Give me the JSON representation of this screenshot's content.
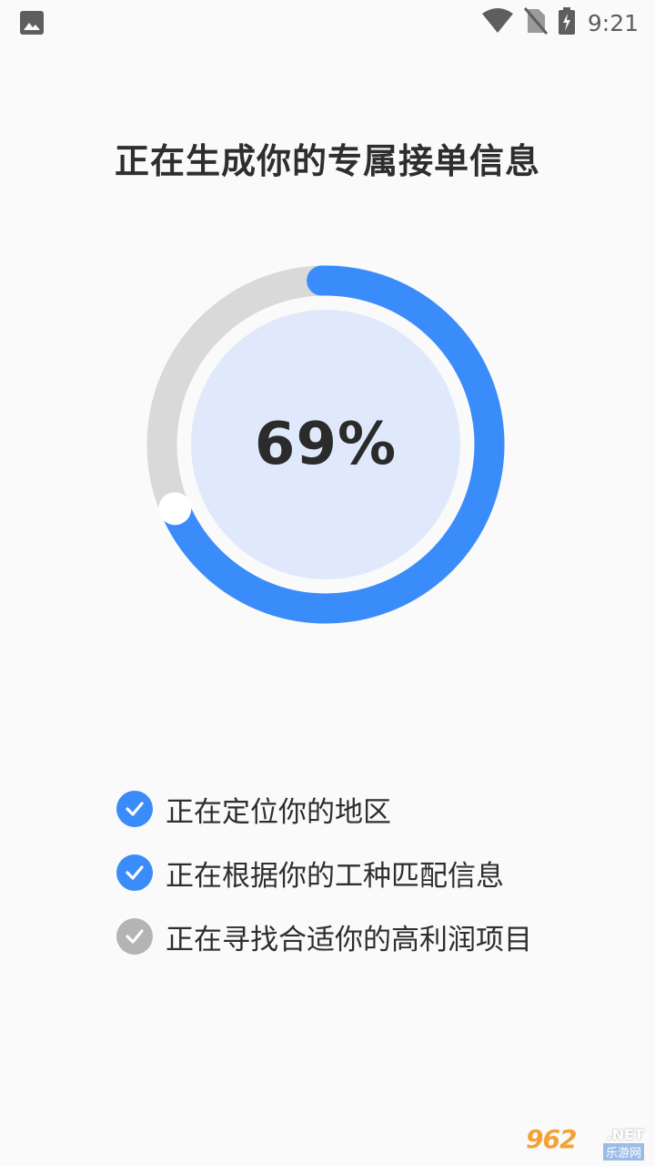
{
  "status_bar": {
    "time": "9:21",
    "icons": [
      "gallery-icon",
      "wifi-icon",
      "no-sim-icon",
      "battery-charging-icon"
    ]
  },
  "title": "正在生成你的专属接单信息",
  "progress": {
    "percent_label": "69%",
    "value": 0.69,
    "colors": {
      "progress": "#3b8cfb",
      "track": "#d9d9d9",
      "inner_fill": "#dfe9fb",
      "knob": "#ffffff"
    }
  },
  "steps": [
    {
      "label": "正在定位你的地区",
      "status": "done",
      "icon": "check-circle-icon",
      "color": "#3b8cfb"
    },
    {
      "label": "正在根据你的工种匹配信息",
      "status": "done",
      "icon": "check-circle-icon",
      "color": "#3b8cfb"
    },
    {
      "label": "正在寻找合适你的高利润项目",
      "status": "pending",
      "icon": "check-circle-icon",
      "color": "#b4b4b4"
    }
  ],
  "watermark": {
    "brand": "962",
    "suffix": ".NET",
    "sub": "乐游网"
  }
}
